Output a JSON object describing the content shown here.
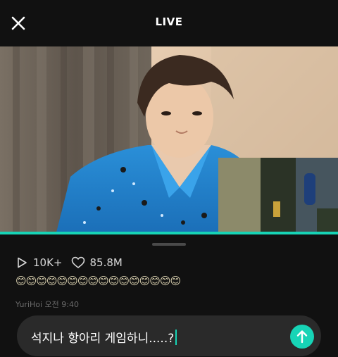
{
  "header": {
    "title": "LIVE",
    "close_icon": "close-icon"
  },
  "player": {
    "progress": 1.0,
    "accent_color": "#17d4b6"
  },
  "stats": {
    "views": "10K+",
    "likes": "85.8M",
    "view_icon": "play-icon",
    "like_icon": "heart-icon"
  },
  "chat": {
    "partial_comment": "😊😊😊😊😊😊😊😊😊😊😊😊😊😊😊😊",
    "author_meta": "YuriHoi  오전 9:40"
  },
  "composer": {
    "value": "석지나 항아리 게임하니.....?",
    "send_icon": "send-arrow-icon"
  }
}
